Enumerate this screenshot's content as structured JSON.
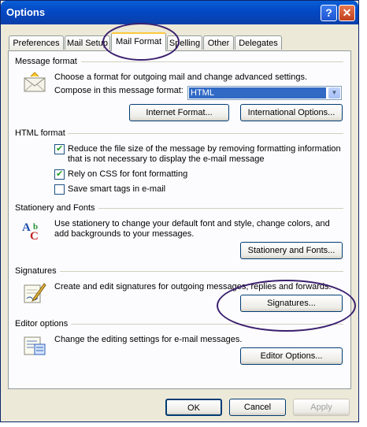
{
  "window": {
    "title": "Options",
    "help_label": "?",
    "close_label": "✕"
  },
  "tabs": [
    {
      "label": "Preferences"
    },
    {
      "label": "Mail Setup"
    },
    {
      "label": "Mail Format"
    },
    {
      "label": "Spelling"
    },
    {
      "label": "Other"
    },
    {
      "label": "Delegates"
    }
  ],
  "message_format": {
    "label": "Message format",
    "description": "Choose a format for outgoing mail and change advanced settings.",
    "compose_label": "Compose in this message format:",
    "compose_value": "HTML",
    "internet_format_button": "Internet Format...",
    "international_options_button": "International Options..."
  },
  "html_format": {
    "label": "HTML format",
    "option1_line1": "Reduce the file size of the message by removing formatting information",
    "option1_line2": "that is not necessary to display the e-mail message",
    "option2": "Rely on CSS for font formatting",
    "option3": "Save smart tags in e-mail",
    "checked": [
      true,
      true,
      false
    ]
  },
  "stationery": {
    "label": "Stationery and Fonts",
    "line1": "Use stationery to change your default font and style, change colors, and",
    "line2": "add backgrounds to your messages.",
    "button": "Stationery and Fonts..."
  },
  "signatures": {
    "label": "Signatures",
    "description": "Create and edit signatures for outgoing messages, replies and forwards.",
    "button": "Signatures..."
  },
  "editor": {
    "label": "Editor options",
    "description": "Change the editing settings for e-mail messages.",
    "button": "Editor Options..."
  },
  "footer": {
    "ok": "OK",
    "cancel": "Cancel",
    "apply": "Apply"
  },
  "colors": {
    "titlebar": "#0348c4",
    "annotation_oval": "#3b1f6e",
    "selection": "#316ac5"
  }
}
